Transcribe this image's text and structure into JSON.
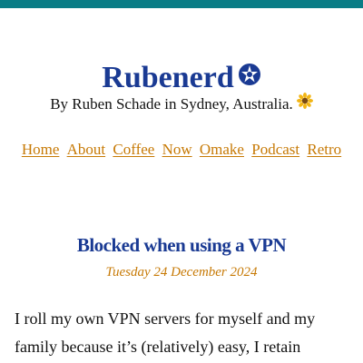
{
  "site": {
    "title": "Rubenerd",
    "title_icon": "star-badge-icon",
    "byline": "By Ruben Schade in Sydney, Australia.",
    "byline_icon": "sunflower-icon",
    "accent_color": "#0a7d86",
    "title_color": "#1a3a93",
    "link_color": "#c77a06"
  },
  "nav": {
    "items": [
      {
        "label": "Home"
      },
      {
        "label": "About"
      },
      {
        "label": "Coffee"
      },
      {
        "label": "Now"
      },
      {
        "label": "Omake"
      },
      {
        "label": "Podcast"
      },
      {
        "label": "Retro"
      }
    ]
  },
  "post": {
    "title": "Blocked when using a VPN",
    "date": "Tuesday 24 December 2024",
    "body": "I roll my own VPN servers for myself and my family because it’s (relatively) easy, I retain"
  }
}
